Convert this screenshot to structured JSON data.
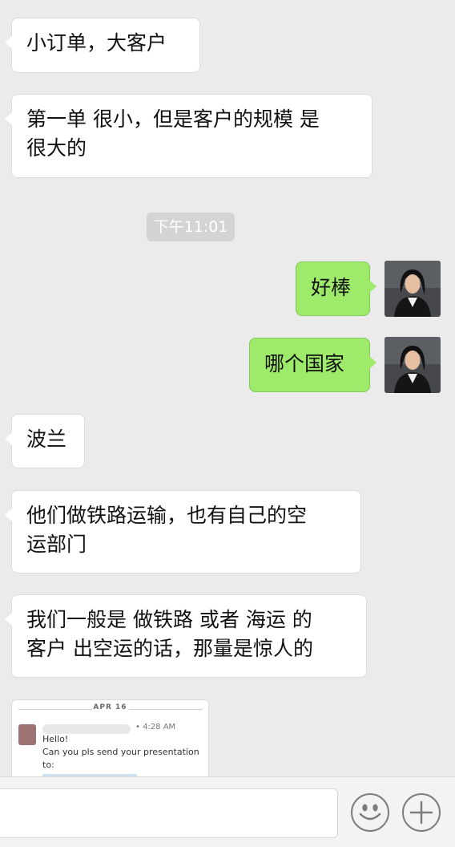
{
  "messages": [
    {
      "side": "in",
      "text": "小订单，大客户"
    },
    {
      "side": "in",
      "lines": [
        "第一单 很小，但是客户的规模 是",
        "很大的"
      ]
    },
    {
      "type": "timestamp",
      "text": "下午11:01"
    },
    {
      "side": "out",
      "text": "好棒"
    },
    {
      "side": "out",
      "text": "哪个国家"
    },
    {
      "side": "in",
      "text": "波兰"
    },
    {
      "side": "in",
      "lines": [
        "他们做铁路运输，也有自己的空",
        "运部门"
      ]
    },
    {
      "side": "in",
      "lines": [
        "我们一般是 做铁路 或者 海运 的",
        "客户 出空运的话，那量是惊人的"
      ]
    }
  ],
  "image_message": {
    "date": "APR 16",
    "time": "• 4:28 AM",
    "lines": [
      "Hello!",
      "Can you pls send your presentation",
      "to:"
    ]
  },
  "input_bar": {
    "emoji_icon": "emoji-icon",
    "plus_icon": "plus-icon"
  },
  "colors": {
    "background": "#ebebeb",
    "outgoing_bubble": "#9eea6a",
    "incoming_bubble": "#ffffff"
  }
}
